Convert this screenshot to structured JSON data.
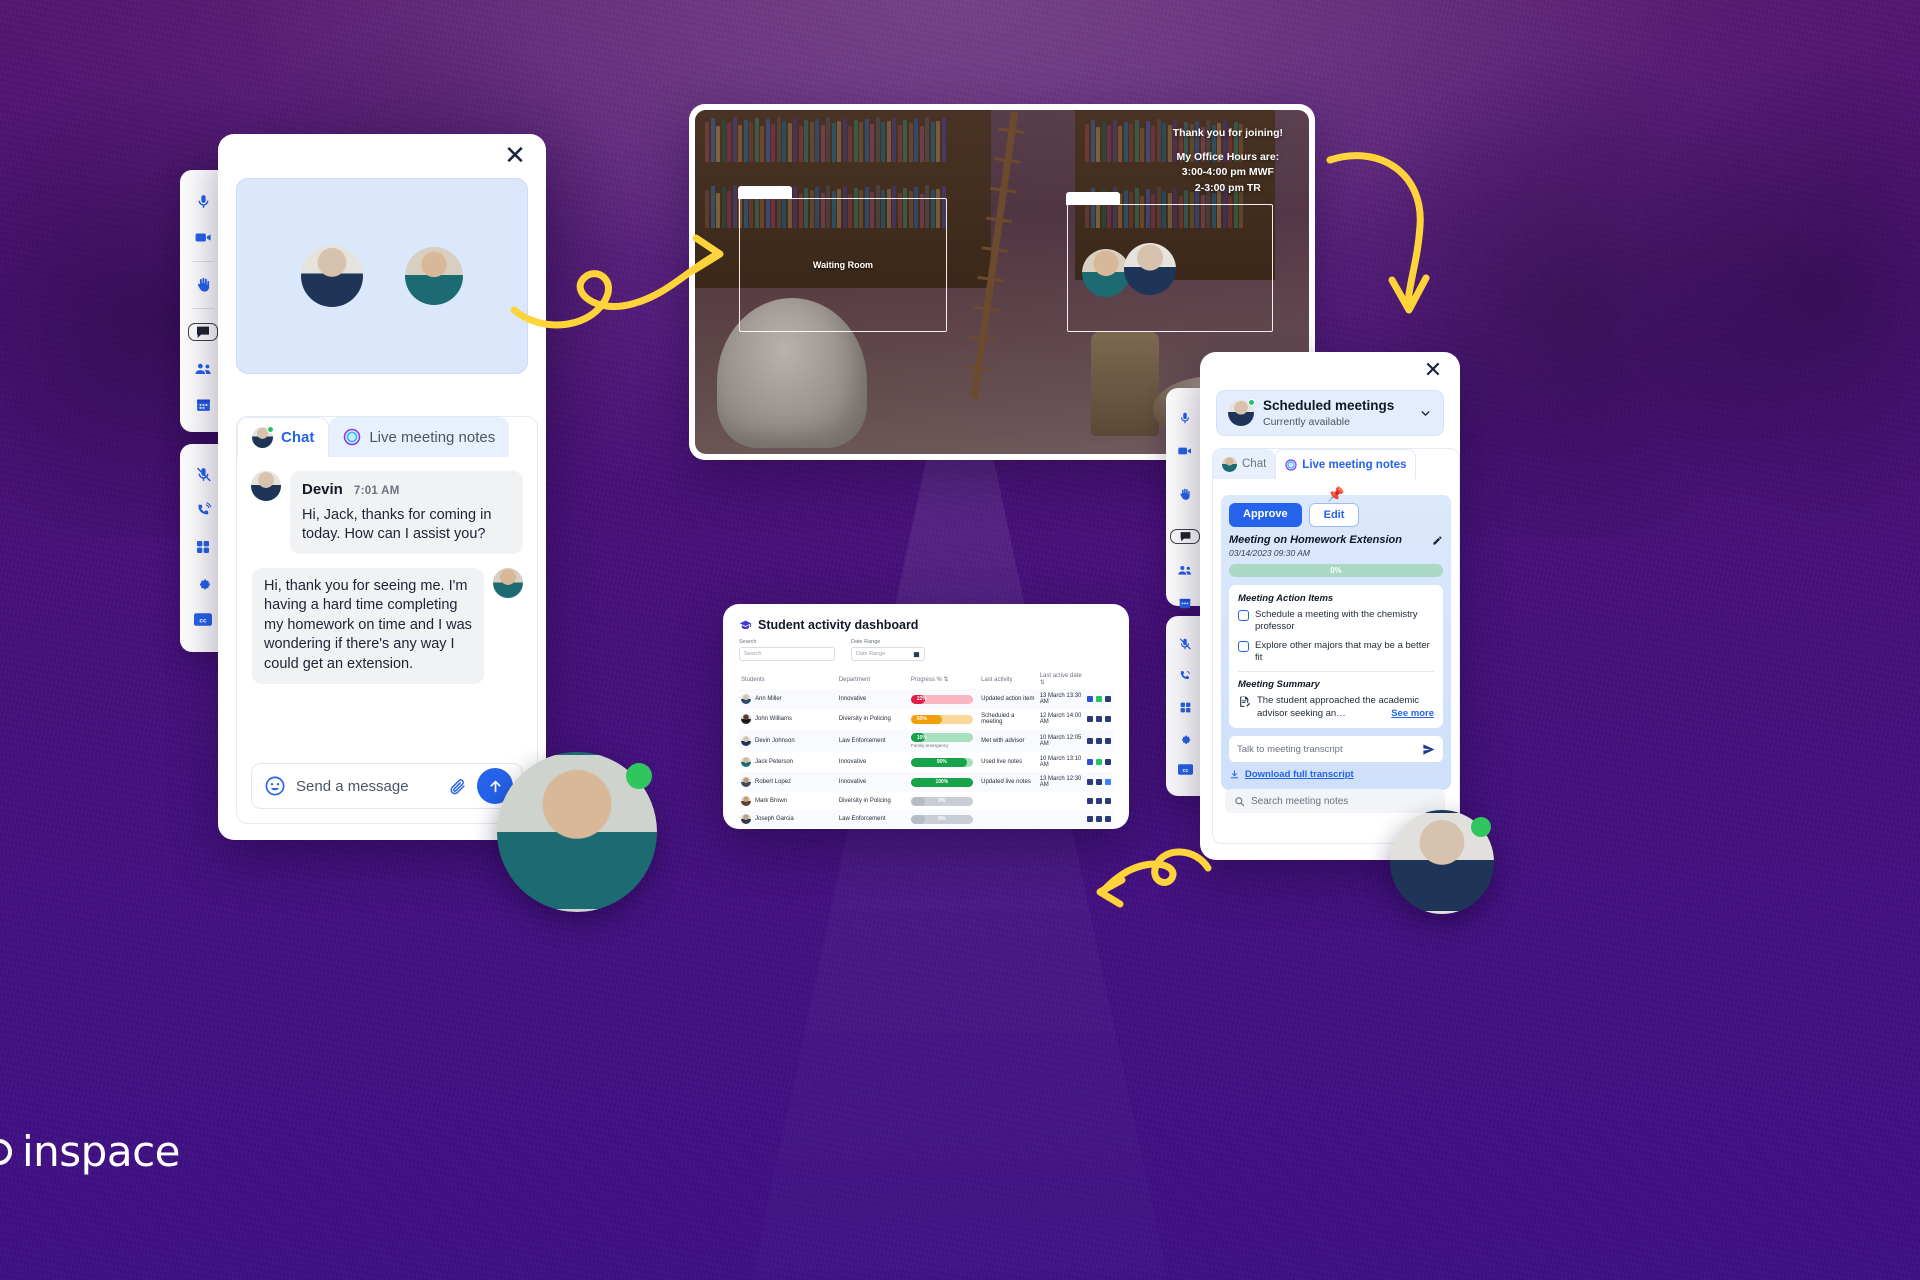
{
  "brand": {
    "name": "inspace",
    "accent": "#2563eb",
    "bg": "#46107a"
  },
  "chat_window": {
    "close_label": "✕",
    "rail_top": [
      {
        "name": "microphone-icon",
        "label": "Microphone"
      },
      {
        "name": "video-camera-icon",
        "label": "Camera"
      },
      {
        "name": "raise-hand-icon",
        "label": "Raise hand"
      },
      {
        "name": "chat-icon",
        "label": "Chat"
      },
      {
        "name": "participants-icon",
        "label": "Participants"
      },
      {
        "name": "calendar-icon",
        "label": "Calendar"
      }
    ],
    "rail_bottom": [
      {
        "name": "mic-muted-icon",
        "label": "Mute"
      },
      {
        "name": "phone-call-icon",
        "label": "Call"
      },
      {
        "name": "grid-view-icon",
        "label": "Grid view"
      },
      {
        "name": "settings-gear-icon",
        "label": "Settings"
      },
      {
        "name": "closed-captions-icon",
        "label": "CC"
      }
    ],
    "tabs": [
      {
        "label": "Chat",
        "active": true
      },
      {
        "label": "Live meeting notes",
        "active": false
      }
    ],
    "messages": [
      {
        "author": "Devin",
        "time": "7:01 AM",
        "text": "Hi, Jack, thanks for coming in today. How can I assist you?",
        "side": "left"
      },
      {
        "author": "",
        "time": "",
        "text": "Hi, thank you for seeing me. I'm having a hard time completing my homework on time and I was wondering if there's any way I could get an extension.",
        "side": "right"
      }
    ],
    "composer": {
      "placeholder": "Send a message",
      "emoji_icon": "smiley-icon",
      "attach_icon": "paperclip-icon",
      "send_icon": "send-arrow-up-icon"
    }
  },
  "video_window": {
    "overlay_note": {
      "line1": "Thank you for joining!",
      "line2": "My Office Hours are:",
      "line3": "3:00-4:00 pm MWF",
      "line4": "2-3:00 pm TR"
    },
    "zones": [
      {
        "label": "Waiting Room",
        "occupants": 0
      },
      {
        "label": "",
        "occupants": 2
      }
    ]
  },
  "notes_window": {
    "close_label": "✕",
    "scheduled": {
      "title": "Scheduled meetings",
      "subtitle": "Currently available",
      "chevron_icon": "chevron-down-icon"
    },
    "tabs": [
      {
        "label": "Chat",
        "active": false
      },
      {
        "label": "Live meeting notes",
        "active": true
      }
    ],
    "note": {
      "pin_icon": "pushpin-icon",
      "approve_label": "Approve",
      "edit_label": "Edit",
      "title": "Meeting on Homework Extension",
      "datetime": "03/14/2023 09:30 AM",
      "progress_label": "0%",
      "progress_value": 0,
      "action_items_header": "Meeting Action Items",
      "action_items": [
        {
          "text": "Schedule a meeting with the chemistry professor",
          "checked": false
        },
        {
          "text": "Explore other majors that may be a better fit",
          "checked": false
        }
      ],
      "summary_header": "Meeting Summary",
      "summary_text": "The student approached the academic advisor seeking an…",
      "see_more_label": "See more",
      "talk_placeholder": "Talk to meeting transcript",
      "send_icon": "send-paper-plane-icon",
      "download_label": "Download full transcript",
      "download_icon": "download-icon"
    },
    "search": {
      "placeholder": "Search meeting notes",
      "icon": "search-icon"
    }
  },
  "dashboard": {
    "title": "Student activity dashboard",
    "title_icon": "graduation-cap-icon",
    "filters": [
      {
        "label": "Search",
        "placeholder": "Search",
        "icon": ""
      },
      {
        "label": "Date Range",
        "placeholder": "Date Range",
        "icon": "calendar-icon"
      }
    ],
    "table": {
      "columns": [
        "Students",
        "Department",
        "Progress % ⇅",
        "Last activity",
        "Last active date ⇅"
      ],
      "rows": [
        {
          "student": "Ann Miller",
          "department": "Innovative",
          "progress": 22,
          "progress_label": "22%",
          "progress_color": "#e11d48",
          "progress_track": "#fbb6c4",
          "note": "",
          "last_activity": "Updated action item",
          "last_active_date": "13 March 13:30 AM",
          "badge": true
        },
        {
          "student": "John Williams",
          "department": "Diversity in Policing",
          "progress": 50,
          "progress_label": "50%",
          "progress_color": "#f59e0b",
          "progress_track": "#fad79a",
          "note": "",
          "last_activity": "Scheduled a meeting",
          "last_active_date": "12 March 14:00 AM",
          "badge": false
        },
        {
          "student": "Devin Johnson",
          "department": "Law Enforcement",
          "progress": 10,
          "progress_label": "10%",
          "progress_color": "#16a34a",
          "progress_track": "#a7e0bd",
          "note": "Family emergency",
          "last_activity": "Met with advisor",
          "last_active_date": "10 March 12:05 AM",
          "badge": false
        },
        {
          "student": "Jack Peterson",
          "department": "Innovative",
          "progress": 90,
          "progress_label": "90%",
          "progress_color": "#16a34a",
          "progress_track": "#a7e0bd",
          "note": "",
          "last_activity": "Used live notes",
          "last_active_date": "10 March 13:10 AM",
          "badge": true
        },
        {
          "student": "Robert Lopez",
          "department": "Innovative",
          "progress": 100,
          "progress_label": "100%",
          "progress_color": "#16a34a",
          "progress_track": "#a7e0bd",
          "note": "",
          "last_activity": "Updated live notes",
          "last_active_date": "13 March 12:30 AM",
          "badge": false
        },
        {
          "student": "Mark Brown",
          "department": "Diversity in Policing",
          "progress": 0,
          "progress_label": "0%",
          "progress_color": "#b6bcc6",
          "progress_track": "#c8cdd6",
          "note": "",
          "last_activity": "",
          "last_active_date": "",
          "badge": false
        },
        {
          "student": "Joseph Garcia",
          "department": "Law Enforcement",
          "progress": 0,
          "progress_label": "0%",
          "progress_color": "#b6bcc6",
          "progress_track": "#c8cdd6",
          "note": "",
          "last_activity": "",
          "last_active_date": "",
          "badge": false
        }
      ]
    }
  },
  "chart_data": {
    "type": "bar",
    "title": "Student activity dashboard — Progress %",
    "categories": [
      "Ann Miller",
      "John Williams",
      "Devin Johnson",
      "Jack Peterson",
      "Robert Lopez",
      "Mark Brown",
      "Joseph Garcia"
    ],
    "values": [
      22,
      50,
      10,
      90,
      100,
      0,
      0
    ],
    "xlabel": "Students",
    "ylabel": "Progress %",
    "ylim": [
      0,
      100
    ]
  }
}
